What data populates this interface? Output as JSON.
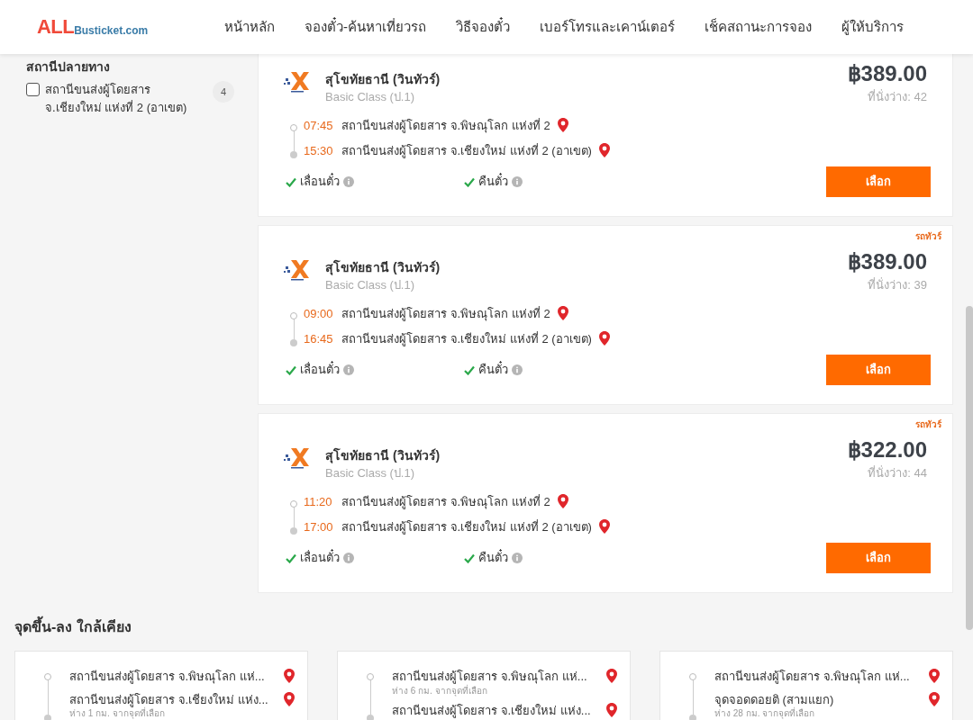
{
  "header": {
    "logo": {
      "main": "ALL",
      "sub": "Busticket.com"
    },
    "nav": [
      {
        "label": "หน้าหลัก"
      },
      {
        "label": "จองตั๋ว-ค้นหาเที่ยวรถ"
      },
      {
        "label": "วิธีจองตั๋ว"
      },
      {
        "label": "เบอร์โทรและเคาน์เตอร์"
      },
      {
        "label": "เช็คสถานะการจอง"
      },
      {
        "label": "ผู้ให้บริการ"
      }
    ]
  },
  "sidebar": {
    "title": "สถานีปลายทาง",
    "options": [
      {
        "label": "สถานีขนส่งผู้โดยสาร จ.เชียงใหม่ แห่งที่ 2 (อาเขต)",
        "count": "4",
        "checked": false
      }
    ]
  },
  "trips": [
    {
      "operator": "สุโขทัยธานี (วินทัวร์)",
      "class": "Basic Class (ป.1)",
      "price": "฿389.00",
      "seats": "ที่นั่งว่าง: 42",
      "depart_time": "07:45",
      "depart_station": "สถานีขนส่งผู้โดยสาร จ.พิษณุโลก แห่งที่ 2",
      "arrive_time": "15:30",
      "arrive_station": "สถานีขนส่งผู้โดยสาร จ.เชียงใหม่ แห่งที่ 2 (อาเขต)",
      "features": [
        "เลื่อนตั๋ว",
        "คืนตั๋ว"
      ],
      "button": "เลือก"
    },
    {
      "tag": "รถทัวร์",
      "operator": "สุโขทัยธานี (วินทัวร์)",
      "class": "Basic Class (ป.1)",
      "price": "฿389.00",
      "seats": "ที่นั่งว่าง: 39",
      "depart_time": "09:00",
      "depart_station": "สถานีขนส่งผู้โดยสาร จ.พิษณุโลก แห่งที่ 2",
      "arrive_time": "16:45",
      "arrive_station": "สถานีขนส่งผู้โดยสาร จ.เชียงใหม่ แห่งที่ 2 (อาเขต)",
      "features": [
        "เลื่อนตั๋ว",
        "คืนตั๋ว"
      ],
      "button": "เลือก"
    },
    {
      "tag": "รถทัวร์",
      "operator": "สุโขทัยธานี (วินทัวร์)",
      "class": "Basic Class (ป.1)",
      "price": "฿322.00",
      "seats": "ที่นั่งว่าง: 44",
      "depart_time": "11:20",
      "depart_station": "สถานีขนส่งผู้โดยสาร จ.พิษณุโลก แห่งที่ 2",
      "arrive_time": "17:00",
      "arrive_station": "สถานีขนส่งผู้โดยสาร จ.เชียงใหม่ แห่งที่ 2 (อาเขต)",
      "features": [
        "เลื่อนตั๋ว",
        "คืนตั๋ว"
      ],
      "button": "เลือก"
    }
  ],
  "nearby": {
    "title": "จุดขึ้น-ลง ใกล้เคียง",
    "routes": [
      {
        "stops": [
          {
            "name": "สถานีขนส่งผู้โดยสาร จ.พิษณุโลก แห่..."
          },
          {
            "name": "สถานีขนส่งผู้โดยสาร จ.เชียงใหม่ แห่ง...",
            "note": "ห่าง 1 กม. จากจุดที่เลือก"
          }
        ]
      },
      {
        "stops": [
          {
            "name": "สถานีขนส่งผู้โดยสาร จ.พิษณุโลก แห่...",
            "note": "ห่าง 6 กม. จากจุดที่เลือก"
          },
          {
            "name": "สถานีขนส่งผู้โดยสาร จ.เชียงใหม่ แห่ง..."
          }
        ]
      },
      {
        "stops": [
          {
            "name": "สถานีขนส่งผู้โดยสาร จ.พิษณุโลก แห่..."
          },
          {
            "name": "จุดจอดดอยติ (สามแยก)",
            "note": "ห่าง 28 กม. จากจุดที่เลือก"
          }
        ]
      }
    ]
  }
}
